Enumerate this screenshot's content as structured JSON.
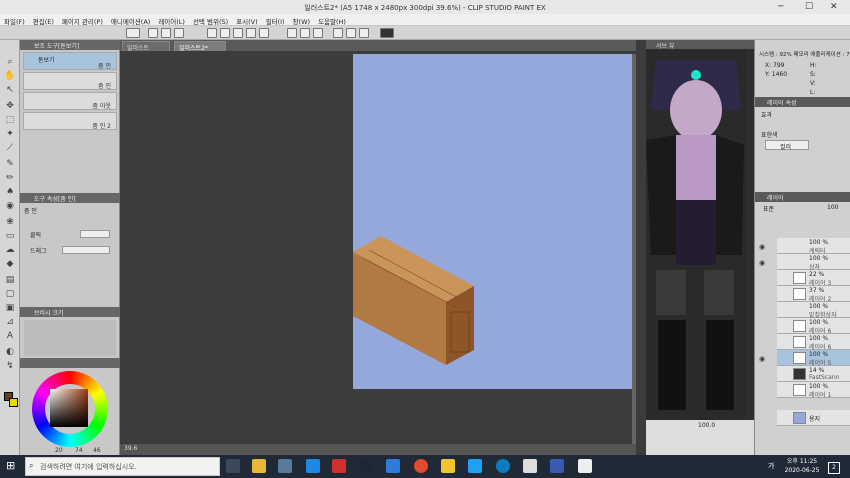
{
  "window": {
    "title": "일러스트2* (A5 1748 x 2480px 300dpi 39.6%)  - CLIP STUDIO PAINT EX",
    "minimize": "─",
    "maximize": "☐",
    "close": "✕"
  },
  "menu": [
    "파일(F)",
    "편집(E)",
    "페이지 관리(P)",
    "애니메이션(A)",
    "레이어(L)",
    "선택 범위(S)",
    "표시(V)",
    "필터(I)",
    "창(W)",
    "도움말(H)"
  ],
  "tabs": [
    "일러스트",
    "일러스트2*"
  ],
  "subtool_panel": {
    "header": "보조 도구[돋보기]",
    "items": [
      {
        "label": "돋보기",
        "name": "줌 인"
      },
      {
        "label": "",
        "name": "줌 아웃"
      },
      {
        "label": "",
        "name": "줌 인 2"
      }
    ]
  },
  "tool_property": {
    "header": "도구 속성[줌 인]",
    "title": "줌 인",
    "rows": [
      "클릭",
      "드래그"
    ]
  },
  "brush_size": {
    "header": "브러시 크기"
  },
  "color_values": [
    "20",
    "74",
    "46"
  ],
  "canvas": {
    "zoom": "39.6"
  },
  "navigator": {
    "tab": "내비게이터",
    "tab2": "서브 뷰"
  },
  "info_panel": {
    "title": "시스템 : 92% 메모리 애플리케이션 : 77%",
    "x": "X: 799",
    "y": "Y: 1460",
    "h": "H:",
    "s": "S:",
    "v": "V:",
    "l": "L:"
  },
  "layer_property": {
    "header": "레이어 속성",
    "effect": "효과",
    "expression": "표현색",
    "color": "컬러"
  },
  "layer_panel": {
    "header": "레이어",
    "blend": "표준",
    "opacity": "100",
    "layers": [
      {
        "pct": "100 %",
        "mode": "표준",
        "name": "캐릭터"
      },
      {
        "pct": "100 %",
        "mode": "표준",
        "name": "상자"
      },
      {
        "pct": "22 %",
        "mode": "표준",
        "name": "레이어 3"
      },
      {
        "pct": "37 %",
        "mode": "표준",
        "name": "레이어 2"
      },
      {
        "pct": "100 %",
        "mode": "표준",
        "name": "밑칠함상자"
      },
      {
        "pct": "100 %",
        "mode": "표준",
        "name": "레이어 6"
      },
      {
        "pct": "100 %",
        "mode": "표준",
        "name": "레이어 6"
      },
      {
        "pct": "100 %",
        "mode": "표준",
        "name": "레이어 5"
      },
      {
        "pct": "14 %",
        "mode": "표준",
        "name": "FastScann"
      },
      {
        "pct": "100 %",
        "mode": "표준",
        "name": "레이어 1"
      },
      {
        "pct": "",
        "mode": "",
        "name": "용지"
      }
    ]
  },
  "layer_zoom": "100.0",
  "taskbar": {
    "search_placeholder": "검색하려면 여기에 입력하십시오.",
    "time": "오후 11:25",
    "date": "2020-06-25",
    "ime": "가",
    "notif": "2"
  },
  "colors": {
    "paper": "#95a8dc",
    "wood": "#b07a42",
    "fg": "#6e3a1c",
    "bg": "#e8d800",
    "accent": "#1fe3c8"
  }
}
